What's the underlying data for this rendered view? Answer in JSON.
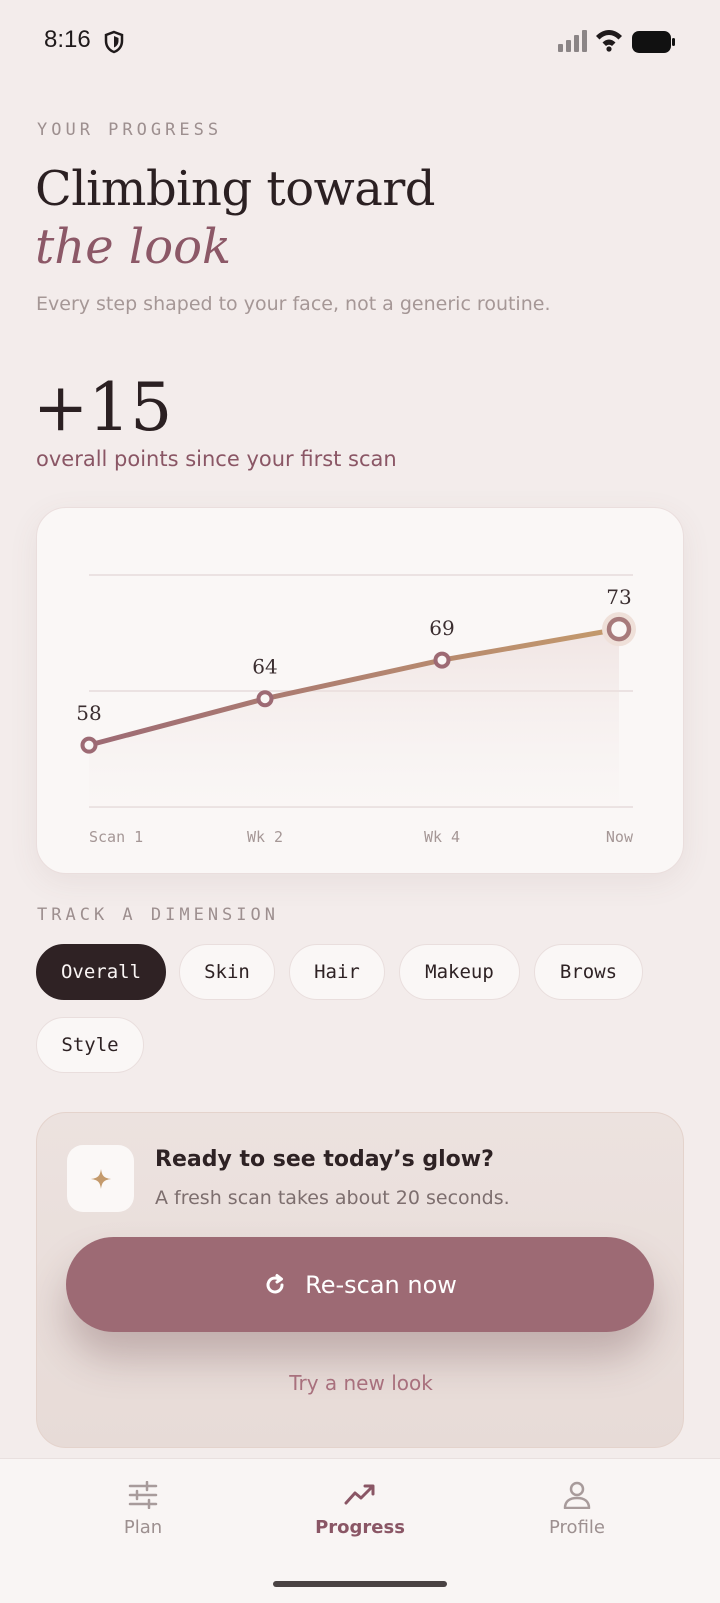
{
  "status_bar": {
    "time": "8:16"
  },
  "header": {
    "eyebrow": "YOUR PROGRESS",
    "title_line1": "Climbing toward",
    "title_line2": "the look",
    "subtitle": "Every step shaped to your face, not a generic routine."
  },
  "summary": {
    "delta": "+15",
    "caption": "overall points since your first scan"
  },
  "chart_data": {
    "type": "line",
    "categories": [
      "Scan 1",
      "Wk 2",
      "Wk 4",
      "Now"
    ],
    "values": [
      58,
      64,
      69,
      73
    ],
    "data_labels": [
      "58",
      "64",
      "69",
      "73"
    ],
    "ylim": [
      50,
      80
    ],
    "grid": true,
    "line_colors": [
      "#9d6a74",
      "#c49a6c"
    ]
  },
  "dimensions": {
    "heading": "TRACK A DIMENSION",
    "chips": [
      "Overall",
      "Skin",
      "Hair",
      "Makeup",
      "Brows",
      "Style"
    ],
    "selected": "Overall"
  },
  "cta": {
    "icon": "sparkle-icon",
    "title": "Ready to see today’s glow?",
    "subtitle": "A fresh scan takes about 20 seconds.",
    "button_label": "Re-scan now",
    "link_label": "Try a new look"
  },
  "nav": {
    "items": [
      {
        "label": "Plan",
        "icon": "sliders-icon"
      },
      {
        "label": "Progress",
        "icon": "trending-up-icon"
      },
      {
        "label": "Profile",
        "icon": "person-icon"
      }
    ],
    "active": "Progress"
  },
  "colors": {
    "accent": "#9d6a74",
    "accent_dark": "#2f2224",
    "gold": "#c49a6c",
    "background": "#f3eceb"
  }
}
